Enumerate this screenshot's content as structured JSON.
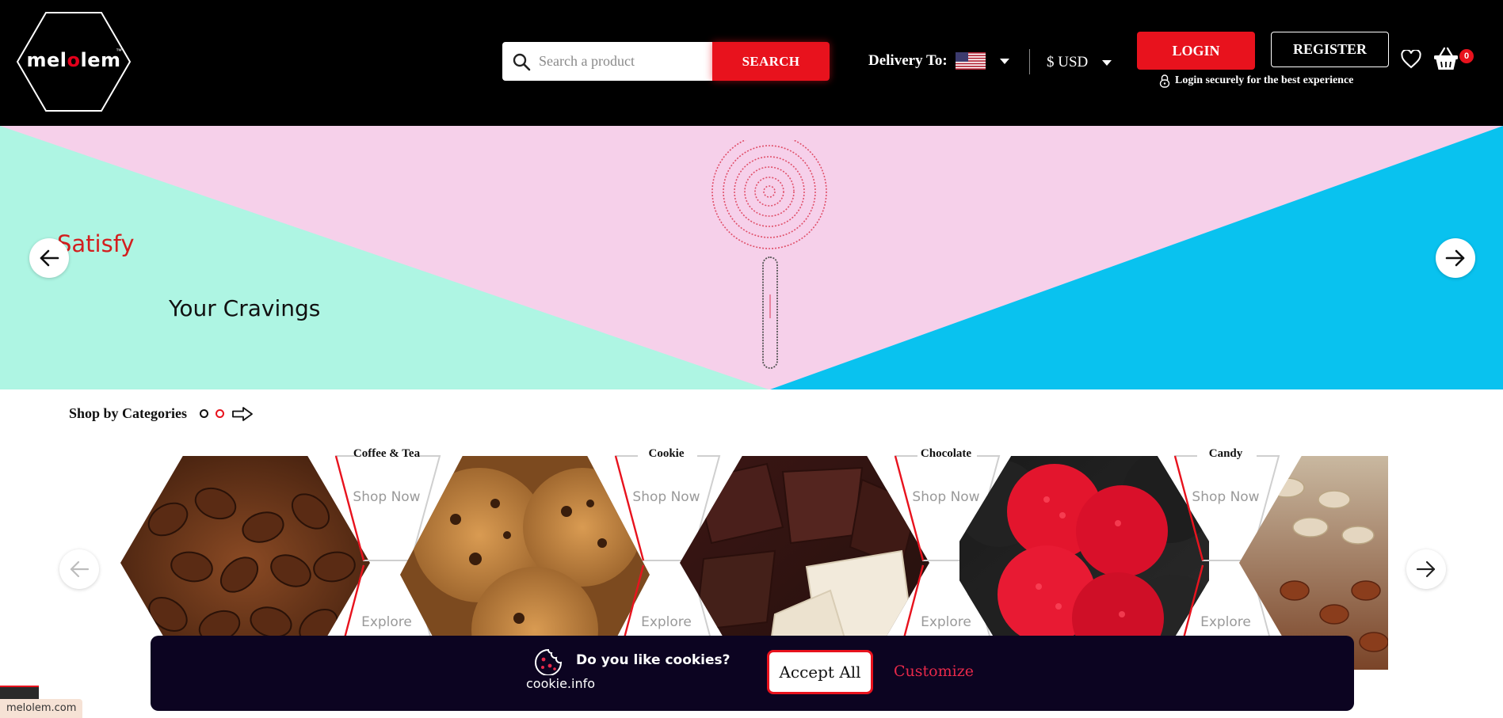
{
  "brand": {
    "logo_text_pre": "mel",
    "logo_text_o": "o",
    "logo_text_post": "lem",
    "logo_tm": "™",
    "accent_color": "#e8121d"
  },
  "header": {
    "search": {
      "placeholder": "Search a product",
      "button_label": "SEARCH",
      "icon": "search-icon"
    },
    "delivery": {
      "label": "Delivery To:",
      "flag": "us-flag-icon"
    },
    "currency": {
      "label": "$ USD"
    },
    "auth": {
      "login_label": "LOGIN",
      "register_label": "REGISTER",
      "secure_note": "Login securely for the best experience"
    },
    "cart": {
      "count": "0",
      "icon": "basket-icon"
    },
    "wishlist_icon": "heart-icon"
  },
  "hero": {
    "line1": "Satisfy",
    "line2": "Your Cravings",
    "colors": {
      "left": "#aef5e3",
      "middle": "#f6d0ea",
      "right": "#09c2ef"
    },
    "image": "lollipop-word-art"
  },
  "categories": {
    "title": "Shop by Categories",
    "items": [
      {
        "name": "Coffee & Tea",
        "shop": "Shop Now",
        "explore": "Explore",
        "image": "coffee-beans"
      },
      {
        "name": "Cookie",
        "shop": "Shop Now",
        "explore": "Explore",
        "image": "chocolate-chip-cookies"
      },
      {
        "name": "Chocolate",
        "shop": "Shop Now",
        "explore": "Explore",
        "image": "chocolate-pieces"
      },
      {
        "name": "Candy",
        "shop": "Shop Now",
        "explore": "Explore",
        "image": "raspberry-gummies"
      }
    ],
    "partial_item_image": "granola-nuts"
  },
  "cookie_banner": {
    "question": "Do you like cookies?",
    "source": "cookie.info",
    "accept_label": "Accept All",
    "customize_label": "Customize"
  },
  "status_bar": {
    "url": "melolem.com"
  }
}
